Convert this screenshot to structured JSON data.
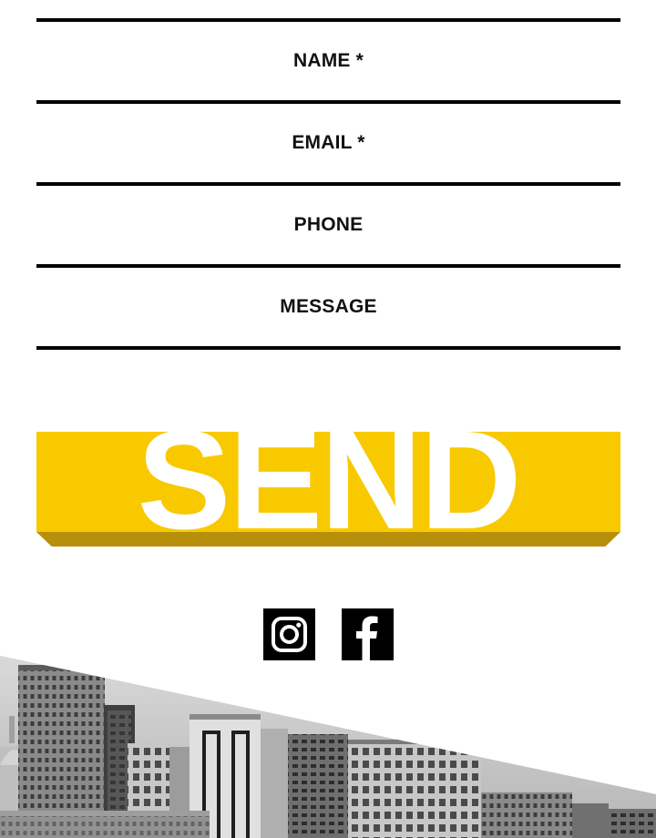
{
  "form": {
    "fields": [
      {
        "label": "NAME *"
      },
      {
        "label": "EMAIL *"
      },
      {
        "label": "PHONE"
      },
      {
        "label": "MESSAGE"
      }
    ],
    "send_label": "SEND"
  },
  "social": {
    "items": [
      {
        "icon": "instagram-icon"
      },
      {
        "icon": "facebook-icon"
      }
    ]
  },
  "colors": {
    "accent": "#f9c900",
    "accent_shadow": "#b88f0a",
    "rule": "#000000",
    "text": "#111111"
  }
}
